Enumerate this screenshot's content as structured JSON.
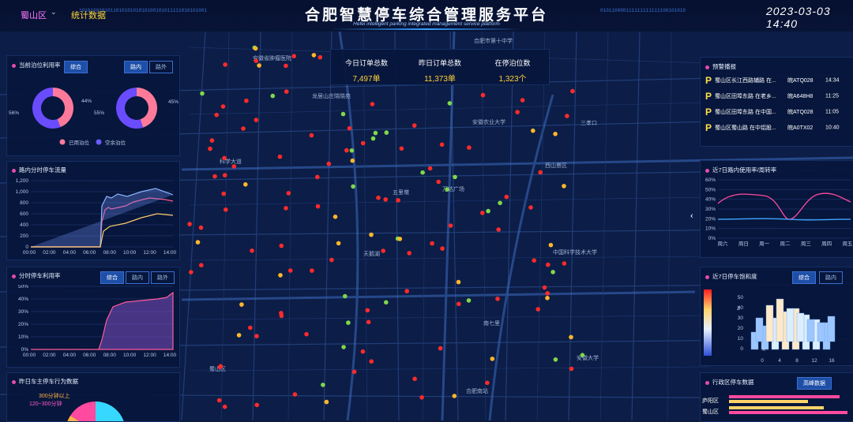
{
  "header": {
    "title": "合肥智慧停车综合管理服务平台",
    "subtitle": "Hefei intelligent parking integrated management service platform",
    "district": "蜀山区",
    "stats_tab": "统计数据",
    "datetime": "2023-03-03 14:40",
    "binary_left": "101010010101101010101010100101011111010101001",
    "binary_right": "010110000111111111111100101010"
  },
  "kpis": [
    {
      "label": "今日订单总数",
      "value": "7,497单"
    },
    {
      "label": "昨日订单总数",
      "value": "11,373单"
    },
    {
      "label": "在停泊位数",
      "value": "1,323个"
    }
  ],
  "util_panel": {
    "title": "当前泊位利用率",
    "tab_all": "综合",
    "tab_road": "路内",
    "tab_lot": "路外",
    "donut1": {
      "used": 44,
      "free": 56
    },
    "donut2": {
      "used": 45,
      "free": 55
    },
    "legend_used": "已用泊位",
    "legend_free": "空余泊位",
    "colors": {
      "used": "#ff7a7a",
      "free": "#5b4cff"
    }
  },
  "flow_panel": {
    "title": "路内分时停车流量",
    "y_ticks": [
      "1,200",
      "1,000",
      "800",
      "600",
      "400",
      "200",
      "0"
    ],
    "x_ticks": [
      "00:00",
      "02:00",
      "04:00",
      "06:00",
      "08:00",
      "10:00",
      "12:00",
      "14:00"
    ]
  },
  "rate_panel": {
    "title": "分时停车利用率",
    "tab_all": "综合",
    "tab_road": "路内",
    "tab_lot": "路外",
    "y_ticks": [
      "50%",
      "40%",
      "30%",
      "20%",
      "10%",
      "0%"
    ],
    "x_ticks": [
      "00:00",
      "02:00",
      "04:00",
      "06:00",
      "08:00",
      "10:00",
      "12:00",
      "14:00"
    ]
  },
  "owner_panel": {
    "title": "昨日车主停车行为数据",
    "label_a": "300分钟以上",
    "label_b": "120~300分钟"
  },
  "alert_panel": {
    "title": "预警播报",
    "rows": [
      {
        "text": "蜀山区长江西路辅路 在...",
        "plate": "皖ATQ028",
        "time": "14:34"
      },
      {
        "text": "蜀山区田埠东路 在老乡...",
        "plate": "皖A648H8",
        "time": "11:25"
      },
      {
        "text": "蜀山区田埠东路 在中国...",
        "plate": "皖ATQ028",
        "time": "11:05"
      },
      {
        "text": "蜀山区蜀山路 在中铝股...",
        "plate": "皖A0TX02",
        "time": "10:40"
      }
    ]
  },
  "week_panel": {
    "title": "近7日路内使用率/周转率",
    "y_ticks": [
      "60%",
      "50%",
      "40%",
      "30%",
      "20%",
      "10%",
      "0%"
    ],
    "x_ticks": [
      "周六",
      "周日",
      "周一",
      "周二",
      "周三",
      "周四",
      "周五"
    ]
  },
  "bar3d_panel": {
    "title": "近7日停车饱和度",
    "tab_all": "综合",
    "tab_road": "路内",
    "z_label": "Z",
    "x_label": "X",
    "y_ticks": [
      "50",
      "40",
      "30",
      "20",
      "10",
      "0"
    ],
    "x_ticks": [
      "0",
      "4",
      "8",
      "12",
      "16"
    ]
  },
  "region_panel": {
    "title": "行政区停车数据",
    "tab": "高峰数据",
    "rows": [
      "庐阳区",
      "蜀山区"
    ]
  },
  "map_labels": [
    "安徽省肿瘤医院",
    "合肥市第十中学",
    "龙居山庄晓晓苑",
    "三孝口",
    "安徽农业大学",
    "五里墩",
    "西山景区",
    "万达广场",
    "中国科学技术大学",
    "南七里",
    "合肥南站",
    "蜀山区",
    "天鹅湖",
    "科学大道",
    "安徽大学"
  ]
}
